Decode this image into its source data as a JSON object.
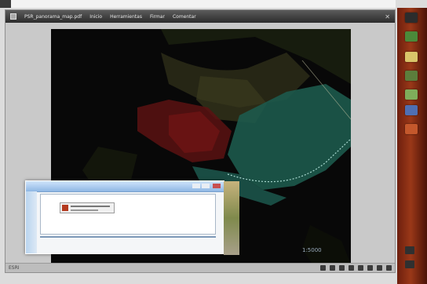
{
  "window": {
    "title": "PSR_panorama_map.pdf",
    "menu": [
      "Inicio",
      "Herramientas",
      "Firmar",
      "Comentar"
    ]
  },
  "map": {
    "zoom_label": "1:5000"
  },
  "status": {
    "left": "ESRI"
  },
  "icons": {
    "document": "document-icon",
    "close": "close-icon"
  },
  "colors": {
    "taskbar": "#9a3818",
    "red_zone": "#6b1616",
    "cyan_zone": "#1f6a5c"
  }
}
